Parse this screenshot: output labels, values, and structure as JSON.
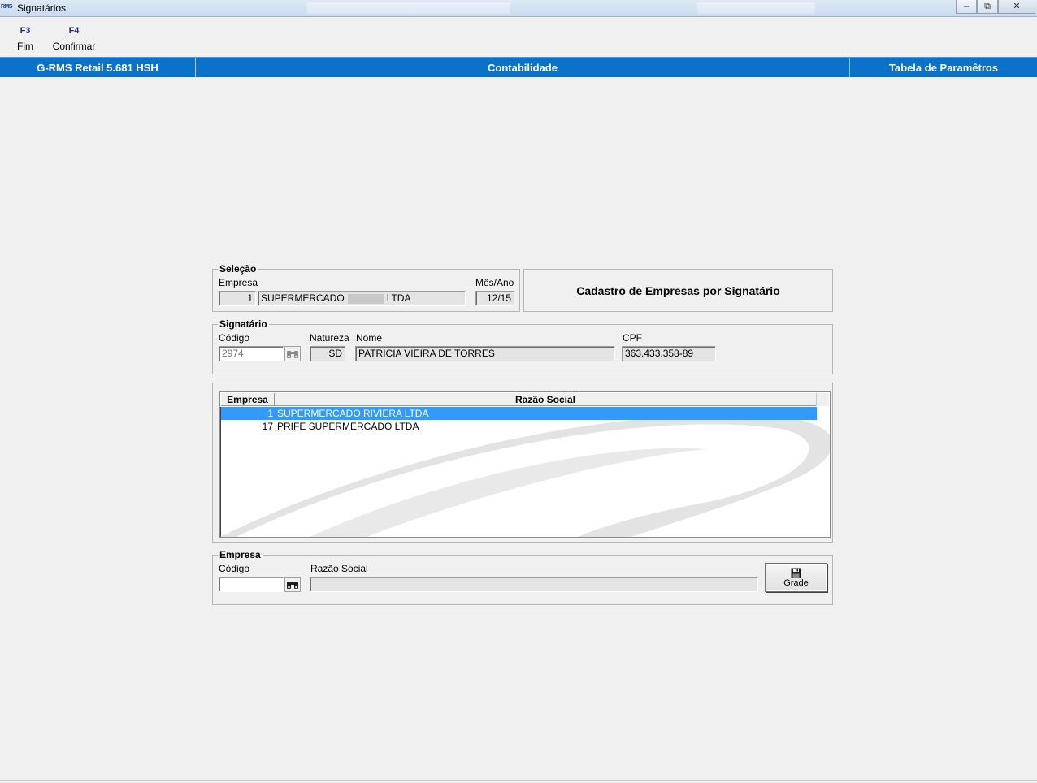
{
  "window": {
    "app_icon_text": "RMS",
    "title": "Signatários"
  },
  "function_keys": [
    {
      "key": "F3",
      "label": "Fim"
    },
    {
      "key": "F4",
      "label": "Confirmar"
    }
  ],
  "header": {
    "left": "G-RMS Retail 5.681 HSH",
    "center": "Contabilidade",
    "right": "Tabela de Paramêtros"
  },
  "selecao": {
    "legend": "Seleção",
    "empresa_label": "Empresa",
    "empresa_codigo": "1",
    "empresa_nome_prefix": "SUPERMERCADO",
    "empresa_nome_suffix": "LTDA",
    "mes_ano_label": "Mês/Ano",
    "mes_ano": "12/15"
  },
  "form_title": "Cadastro de Empresas por Signatário",
  "signatario": {
    "legend": "Signatário",
    "codigo_label": "Código",
    "codigo": "2974",
    "natureza_label": "Natureza",
    "natureza": "SD",
    "nome_label": "Nome",
    "nome": "PATRICIA VIEIRA DE TORRES",
    "cpf_label": "CPF",
    "cpf": "363.433.358-89"
  },
  "grid": {
    "columns": [
      "Empresa",
      "Razão Social"
    ],
    "rows": [
      {
        "empresa": "1",
        "razao_social": "SUPERMERCADO RIVIERA LTDA",
        "selected": true
      },
      {
        "empresa": "17",
        "razao_social": "PRIFE SUPERMERCADO LTDA",
        "selected": false
      }
    ]
  },
  "empresa": {
    "legend": "Empresa",
    "codigo_label": "Código",
    "codigo": "",
    "razao_social_label": "Razão Social",
    "razao_social": "",
    "grade_button": "Grade"
  },
  "colors": {
    "header_blue": "#0a72c8",
    "selection_blue": "#3399ff",
    "label_navy": "#1a2a78"
  }
}
